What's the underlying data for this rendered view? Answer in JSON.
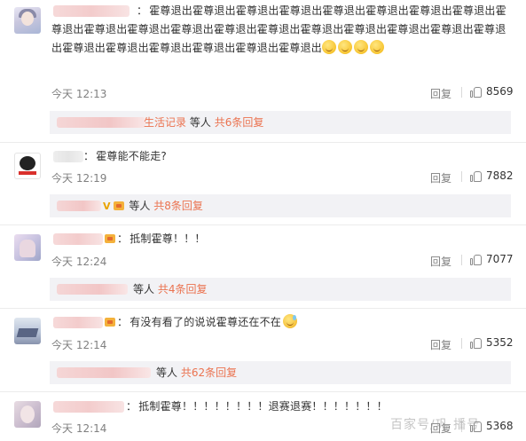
{
  "labels": {
    "reply": "回复",
    "others": "等人"
  },
  "comments": [
    {
      "text": "霍尊退出霍尊退出霍尊退出霍尊退出霍尊退出霍尊退出霍尊退出霍尊退出霍尊退出霍尊退出霍尊退出霍尊退出霍尊退出霍尊退出霍尊退出霍尊退出霍尊退出霍尊退出霍尊退出霍尊退出霍尊退出霍尊退出霍尊退出霍尊退出霍尊退出",
      "time": "今天 12:13",
      "likes": "8569",
      "sub": {
        "label": "生活记录",
        "count": "共6条回复"
      }
    },
    {
      "text": "霍尊能不能走?",
      "time": "今天 12:19",
      "likes": "7882",
      "sub": {
        "badge": "V",
        "count": "共8条回复"
      }
    },
    {
      "text": "抵制霍尊！！！",
      "time": "今天 12:24",
      "likes": "7077",
      "sub": {
        "count": "共4条回复"
      }
    },
    {
      "text": "有没有看了的说说霍尊还在不在",
      "time": "今天 12:14",
      "likes": "5352",
      "sub": {
        "count": "共62条回复"
      }
    },
    {
      "text": "抵制霍尊！！！！！！！！退赛退赛！！！！！！！",
      "time": "今天 12:14",
      "likes": "5368"
    }
  ],
  "watermark": "百家号/巩  播号",
  "colors": {
    "accent": "#eb7350",
    "muted": "#808080",
    "panel": "#f2f2f5"
  }
}
